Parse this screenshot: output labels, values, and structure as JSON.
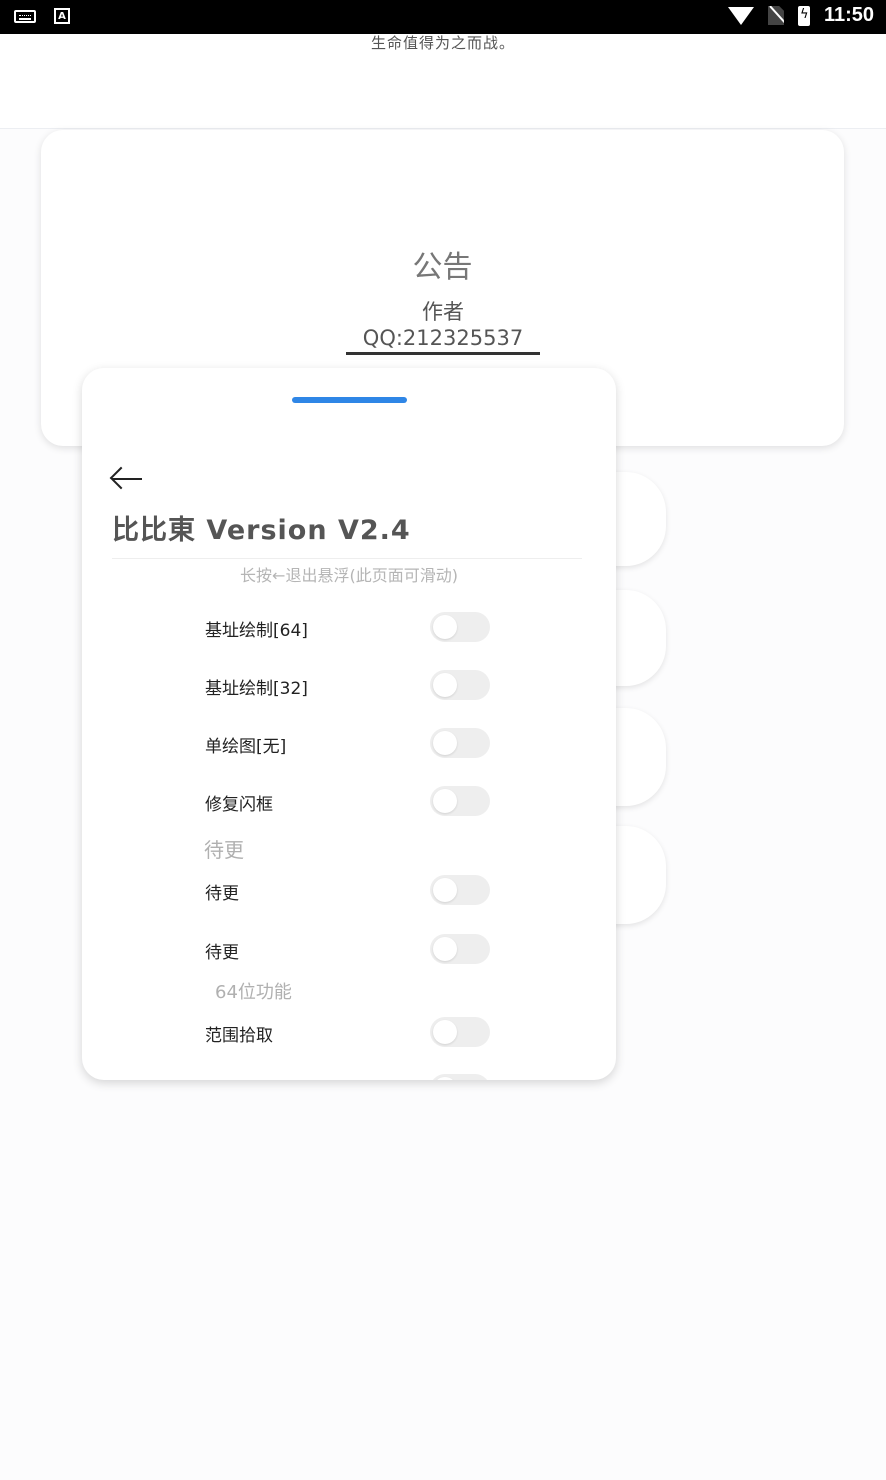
{
  "status_bar": {
    "time": "11:50",
    "a_badge": "A"
  },
  "top": {
    "motto": "生命值得为之而战。"
  },
  "notice": {
    "title": "公告",
    "author": "作者QQ:212325537"
  },
  "panel": {
    "title": "比比東 Version V2.4",
    "hint": "长按←退出悬浮(此页面可滑动)",
    "rows": [
      {
        "label": "基址绘制[64]",
        "on": false
      },
      {
        "label": "基址绘制[32]",
        "on": false
      },
      {
        "label": "单绘图[无]",
        "on": false
      },
      {
        "label": "修复闪框",
        "on": false
      },
      {
        "label": "待更",
        "on": false
      },
      {
        "label": "待更",
        "on": false
      },
      {
        "label": "范围拾取",
        "on": false
      }
    ],
    "sections": [
      "待更",
      "64位功能"
    ]
  },
  "colors": {
    "accent": "#2f86e6",
    "toggle_off": "#eeeeee"
  }
}
